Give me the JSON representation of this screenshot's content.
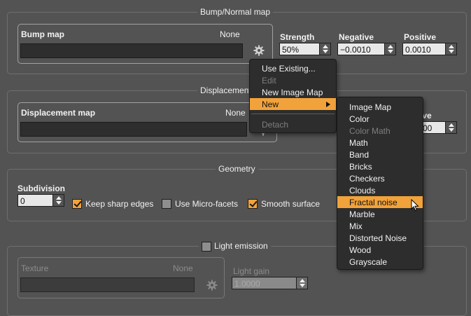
{
  "bump_group": {
    "title": "Bump/Normal map",
    "map_label": "Bump map",
    "map_value": "None",
    "strength_label": "Strength",
    "strength_value": "50%",
    "negative_label": "Negative",
    "negative_value": "−0.0010",
    "positive_label": "Positive",
    "positive_value": "0.0010"
  },
  "displacement_group": {
    "title": "Displacement",
    "map_label": "Displacement map",
    "map_value": "None",
    "partial_label": "ive",
    "partial_value": "00"
  },
  "geometry_group": {
    "title": "Geometry",
    "subdivision_label": "Subdivision",
    "subdivision_value": "0",
    "keep_sharp_edges": {
      "label": "Keep sharp edges",
      "checked": true
    },
    "use_micro_facets": {
      "label": "Use Micro-facets",
      "checked": false
    },
    "smooth_surface": {
      "label": "Smooth surface",
      "checked": true
    }
  },
  "light_emission_group": {
    "title": "Light emission",
    "enabled": false,
    "texture_label": "Texture",
    "texture_value": "None",
    "light_gain_label": "Light gain",
    "light_gain_value": "1.0000"
  },
  "context_menu": {
    "items": [
      {
        "label": "Use Existing...",
        "enabled": true
      },
      {
        "label": "Edit",
        "enabled": false
      },
      {
        "label": "New Image Map",
        "enabled": true
      },
      {
        "label": "New",
        "enabled": true,
        "highlighted": true,
        "has_submenu": true
      },
      {
        "label": "Detach",
        "enabled": false
      }
    ]
  },
  "new_submenu": {
    "items": [
      {
        "label": "Image Map",
        "enabled": true
      },
      {
        "label": "Color",
        "enabled": true
      },
      {
        "label": "Color Math",
        "enabled": false
      },
      {
        "label": "Math",
        "enabled": true
      },
      {
        "label": "Band",
        "enabled": true
      },
      {
        "label": "Bricks",
        "enabled": true
      },
      {
        "label": "Checkers",
        "enabled": true
      },
      {
        "label": "Clouds",
        "enabled": true
      },
      {
        "label": "Fractal noise",
        "enabled": true,
        "highlighted": true
      },
      {
        "label": "Marble",
        "enabled": true
      },
      {
        "label": "Mix",
        "enabled": true
      },
      {
        "label": "Distorted Noise",
        "enabled": true
      },
      {
        "label": "Wood",
        "enabled": true
      },
      {
        "label": "Grayscale",
        "enabled": true
      }
    ]
  },
  "icons": {
    "settings": "gear-icon",
    "submenu": "triangle-right-icon",
    "cursor": "mouse-pointer-icon"
  },
  "colors": {
    "background": "#535353",
    "accent": "#f2a23a",
    "menu_bg": "#2d2d2d",
    "field_bg": "#2e2e2e"
  }
}
